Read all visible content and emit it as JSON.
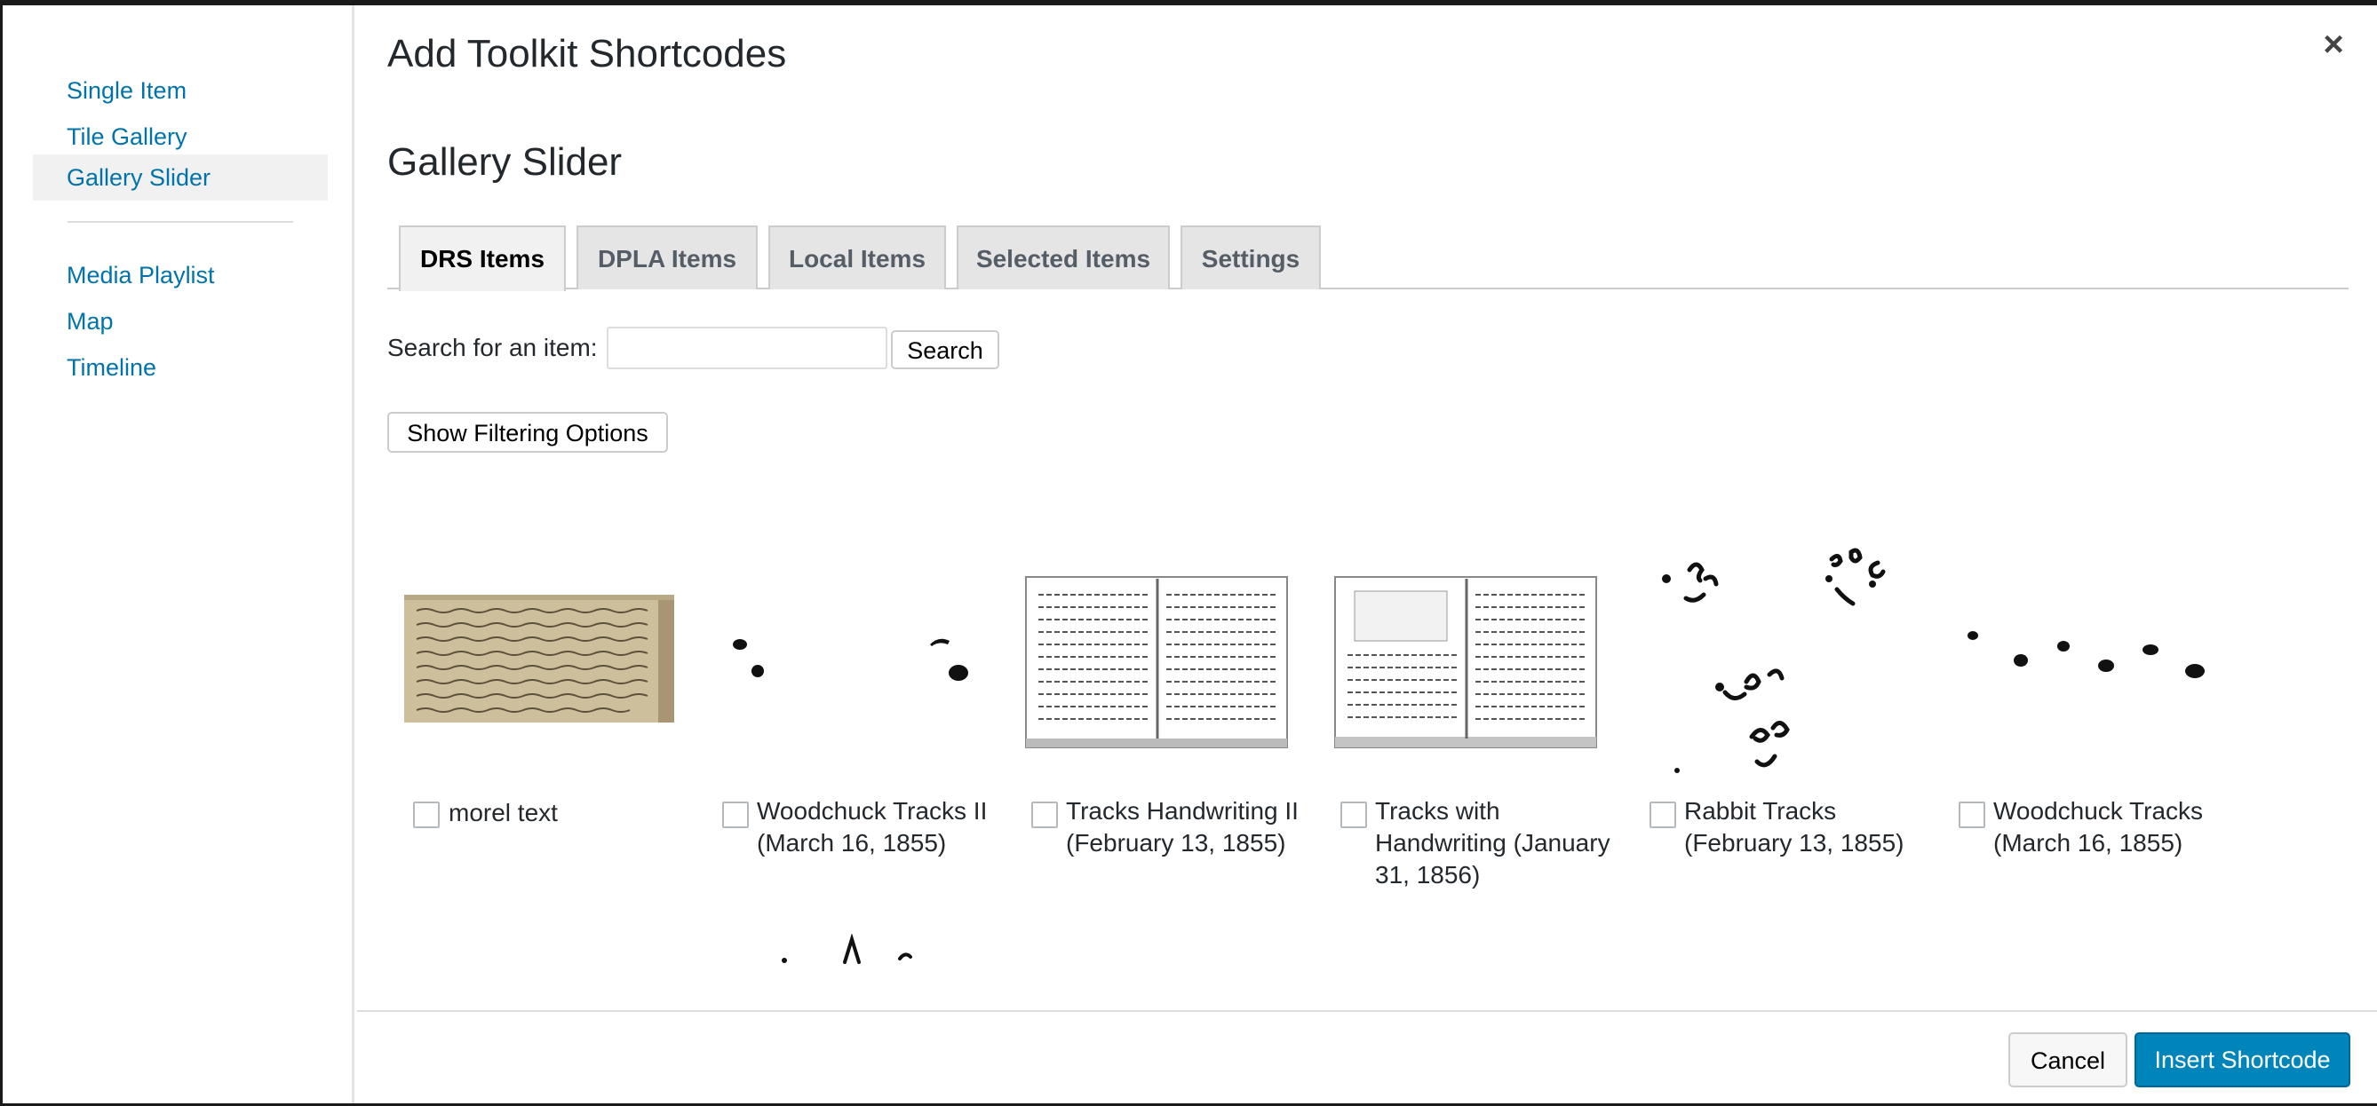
{
  "modal": {
    "title": "Add Toolkit Shortcodes",
    "close_symbol": "×"
  },
  "sidebar": {
    "items": [
      {
        "label": "Single Item"
      },
      {
        "label": "Tile Gallery"
      },
      {
        "label": "Gallery Slider",
        "active": true
      },
      {
        "label": "Media Playlist"
      },
      {
        "label": "Map"
      },
      {
        "label": "Timeline"
      }
    ]
  },
  "main": {
    "section_title": "Gallery Slider",
    "tabs": [
      {
        "label": "DRS Items",
        "active": true
      },
      {
        "label": "DPLA Items"
      },
      {
        "label": "Local Items"
      },
      {
        "label": "Selected Items"
      },
      {
        "label": "Settings"
      }
    ],
    "search": {
      "label": "Search for an item:",
      "value": "",
      "button": "Search"
    },
    "filter_button": "Show Filtering Options",
    "items": [
      {
        "title": "morel text",
        "checked": false,
        "thumb": "handwritten-manuscript-icon"
      },
      {
        "title": "Woodchuck Tracks II (March 16, 1855)",
        "checked": false,
        "thumb": "animal-tracks-icon"
      },
      {
        "title": "Tracks Handwriting II (February 13, 1855)",
        "checked": false,
        "thumb": "journal-pages-icon"
      },
      {
        "title": "Tracks with Handwriting (January 31, 1856)",
        "checked": false,
        "thumb": "journal-pages-icon"
      },
      {
        "title": "Rabbit Tracks (February 13, 1855)",
        "checked": false,
        "thumb": "animal-tracks-icon"
      },
      {
        "title": "Woodchuck Tracks (March 16, 1855)",
        "checked": false,
        "thumb": "animal-tracks-icon"
      }
    ]
  },
  "footer": {
    "cancel": "Cancel",
    "insert": "Insert Shortcode"
  },
  "colors": {
    "link": "#0073aa",
    "primary_button": "#0085ba"
  }
}
